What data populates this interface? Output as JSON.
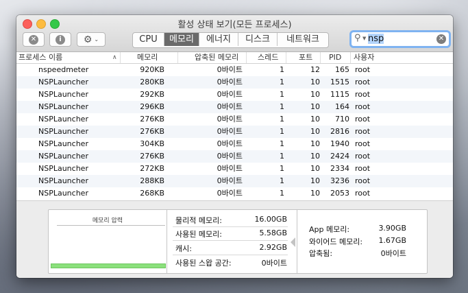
{
  "window": {
    "title": "활성 상태 보기(모든 프로세스)"
  },
  "toolbar": {
    "stop_icon": "stop-x-icon",
    "info_icon": "info-icon",
    "gear_icon": "gear-icon",
    "tabs": [
      {
        "label": "CPU",
        "active": false
      },
      {
        "label": "메모리",
        "active": true
      },
      {
        "label": "에너지",
        "active": false
      },
      {
        "label": "디스크",
        "active": false
      },
      {
        "label": "네트워크",
        "active": false
      }
    ]
  },
  "search": {
    "value": "nsp"
  },
  "table": {
    "columns": [
      "프로세스 이름",
      "메모리",
      "압축된 메모리",
      "스레드",
      "포트",
      "PID",
      "사용자"
    ],
    "rows": [
      {
        "name": "nspeedmeter",
        "memory": "920KB",
        "compressed": "0바이트",
        "threads": "1",
        "ports": "12",
        "pid": "165",
        "user": "root"
      },
      {
        "name": "NSPLauncher",
        "memory": "280KB",
        "compressed": "0바이트",
        "threads": "1",
        "ports": "10",
        "pid": "1515",
        "user": "root"
      },
      {
        "name": "NSPLauncher",
        "memory": "292KB",
        "compressed": "0바이트",
        "threads": "1",
        "ports": "10",
        "pid": "1115",
        "user": "root"
      },
      {
        "name": "NSPLauncher",
        "memory": "296KB",
        "compressed": "0바이트",
        "threads": "1",
        "ports": "10",
        "pid": "164",
        "user": "root"
      },
      {
        "name": "NSPLauncher",
        "memory": "276KB",
        "compressed": "0바이트",
        "threads": "1",
        "ports": "10",
        "pid": "710",
        "user": "root"
      },
      {
        "name": "NSPLauncher",
        "memory": "276KB",
        "compressed": "0바이트",
        "threads": "1",
        "ports": "10",
        "pid": "2816",
        "user": "root"
      },
      {
        "name": "NSPLauncher",
        "memory": "304KB",
        "compressed": "0바이트",
        "threads": "1",
        "ports": "10",
        "pid": "1940",
        "user": "root"
      },
      {
        "name": "NSPLauncher",
        "memory": "276KB",
        "compressed": "0바이트",
        "threads": "1",
        "ports": "10",
        "pid": "2424",
        "user": "root"
      },
      {
        "name": "NSPLauncher",
        "memory": "272KB",
        "compressed": "0바이트",
        "threads": "1",
        "ports": "10",
        "pid": "2334",
        "user": "root"
      },
      {
        "name": "NSPLauncher",
        "memory": "288KB",
        "compressed": "0바이트",
        "threads": "1",
        "ports": "10",
        "pid": "3236",
        "user": "root"
      },
      {
        "name": "NSPLauncher",
        "memory": "268KB",
        "compressed": "0바이트",
        "threads": "1",
        "ports": "10",
        "pid": "2053",
        "user": "root"
      }
    ]
  },
  "summary": {
    "pressure_title": "메모리 압력",
    "pressure_color": "#8be07c",
    "physical_label": "물리적 메모리:",
    "physical_value": "16.00GB",
    "used_label": "사용된 메모리:",
    "used_value": "5.58GB",
    "cache_label": "캐시:",
    "cache_value": "2.92GB",
    "swap_label": "사용된 스왑 공간:",
    "swap_value": "0바이트",
    "app_label": "App 메모리:",
    "app_value": "3.90GB",
    "wired_label": "와이어드 메모리:",
    "wired_value": "1.67GB",
    "compressed_label": "압축됨:",
    "compressed_value": "0바이트"
  }
}
